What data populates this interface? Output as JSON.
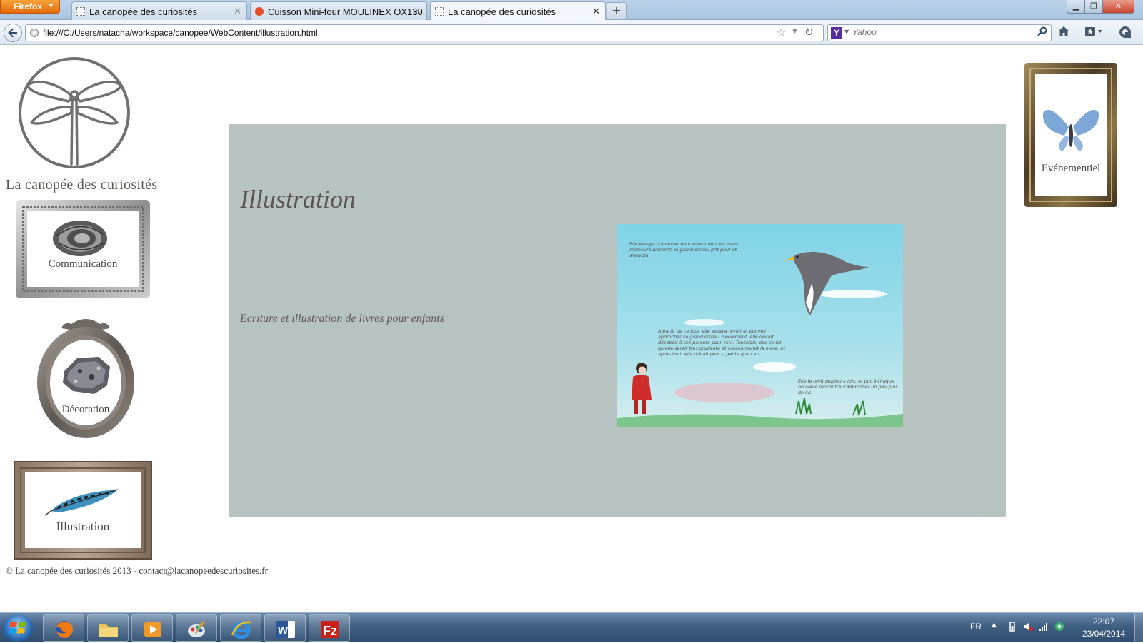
{
  "browser": {
    "menu_button": "Firefox",
    "tabs": [
      {
        "title": "La canopée des curiosités"
      },
      {
        "title": "Cuisson Mini-four MOULINEX OX130..."
      },
      {
        "title": "La canopée des curiosités"
      }
    ],
    "url": "file:///C:/Users/natacha/workspace/canopee/WebContent/illustration.html",
    "search_placeholder": "Yahoo",
    "search_engine_icon": "Y",
    "newtab_label": "+"
  },
  "site": {
    "title": "La canopée des curiosités",
    "nav": {
      "communication": "Communication",
      "decoration": "Décoration",
      "illustration": "Illustration",
      "evenementiel": "Evénementiel"
    },
    "content": {
      "heading": "Illustration",
      "description": "Ecriture et illustration de livres pour enfants"
    },
    "image_text": {
      "top": [
        "Elle essaya d'avancer doucement vers lui, mais",
        "malheureusement, le grand oiseau prit peur et",
        "s'envola."
      ],
      "middle": [
        "A partir de ce jour, elle espéra revoir et pouvoir",
        "approcher ce grand oiseau. Seulement, elle devait",
        "désobéir à ses parents pour cela. Toutefois, elle se dit",
        "qu'elle serait très prudente et contournerait la mare, et",
        "après tout, elle n'était plus si petite que ça !"
      ],
      "bottom": [
        "Elle le revit plusieurs fois, et put à chaque",
        "nouvelle rencontre s'approcher un peu plus",
        "de lui."
      ]
    },
    "footer": "© La canopée des curiosités 2013 - contact@lacanopeedescuriosites.fr",
    "panel_color": "#b7c3c1"
  },
  "taskbar": {
    "language": "FR",
    "time": "22:07",
    "date": "23/04/2014"
  }
}
